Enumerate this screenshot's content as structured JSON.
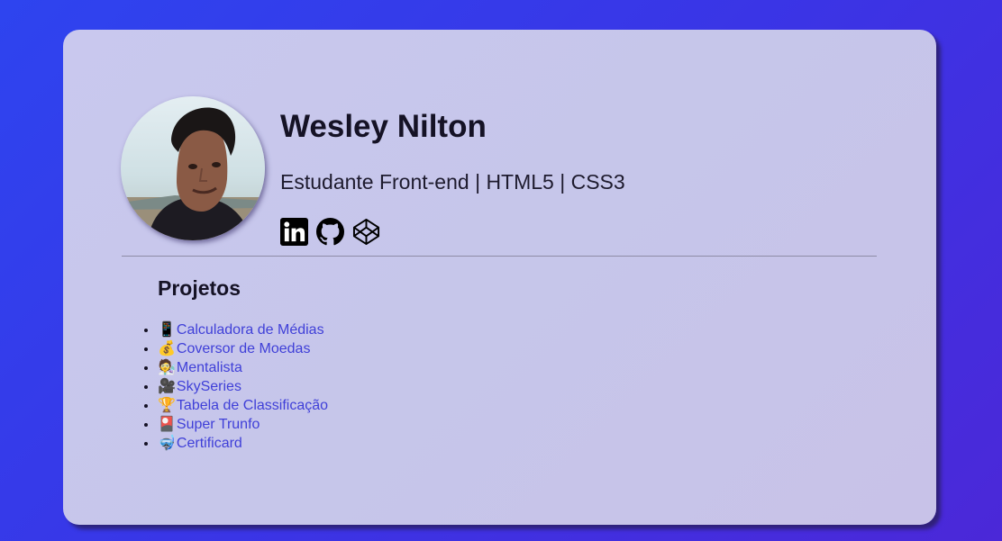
{
  "profile": {
    "name": "Wesley Nilton",
    "role": "Estudante Front-end | HTML5 | CSS3"
  },
  "social": [
    {
      "icon": "linkedin-icon",
      "label": "LinkedIn"
    },
    {
      "icon": "github-icon",
      "label": "GitHub"
    },
    {
      "icon": "codepen-icon",
      "label": "CodePen"
    }
  ],
  "projects": {
    "title": "Projetos",
    "items": [
      {
        "emoji": "📱",
        "label": "Calculadora de Médias"
      },
      {
        "emoji": "💰",
        "label": "Coversor de Moedas"
      },
      {
        "emoji": "🧑‍🔬",
        "label": "Mentalista"
      },
      {
        "emoji": "🎥",
        "label": "SkySeries"
      },
      {
        "emoji": "🏆",
        "label": "Tabela de Classificação"
      },
      {
        "emoji": "🎴",
        "label": "Super Trunfo"
      },
      {
        "emoji": "🤿",
        "label": "Certificard"
      }
    ]
  },
  "colors": {
    "background": "#3a35e6",
    "card": "#c7c6ec",
    "link": "#3f3fd8",
    "text": "#151225"
  }
}
